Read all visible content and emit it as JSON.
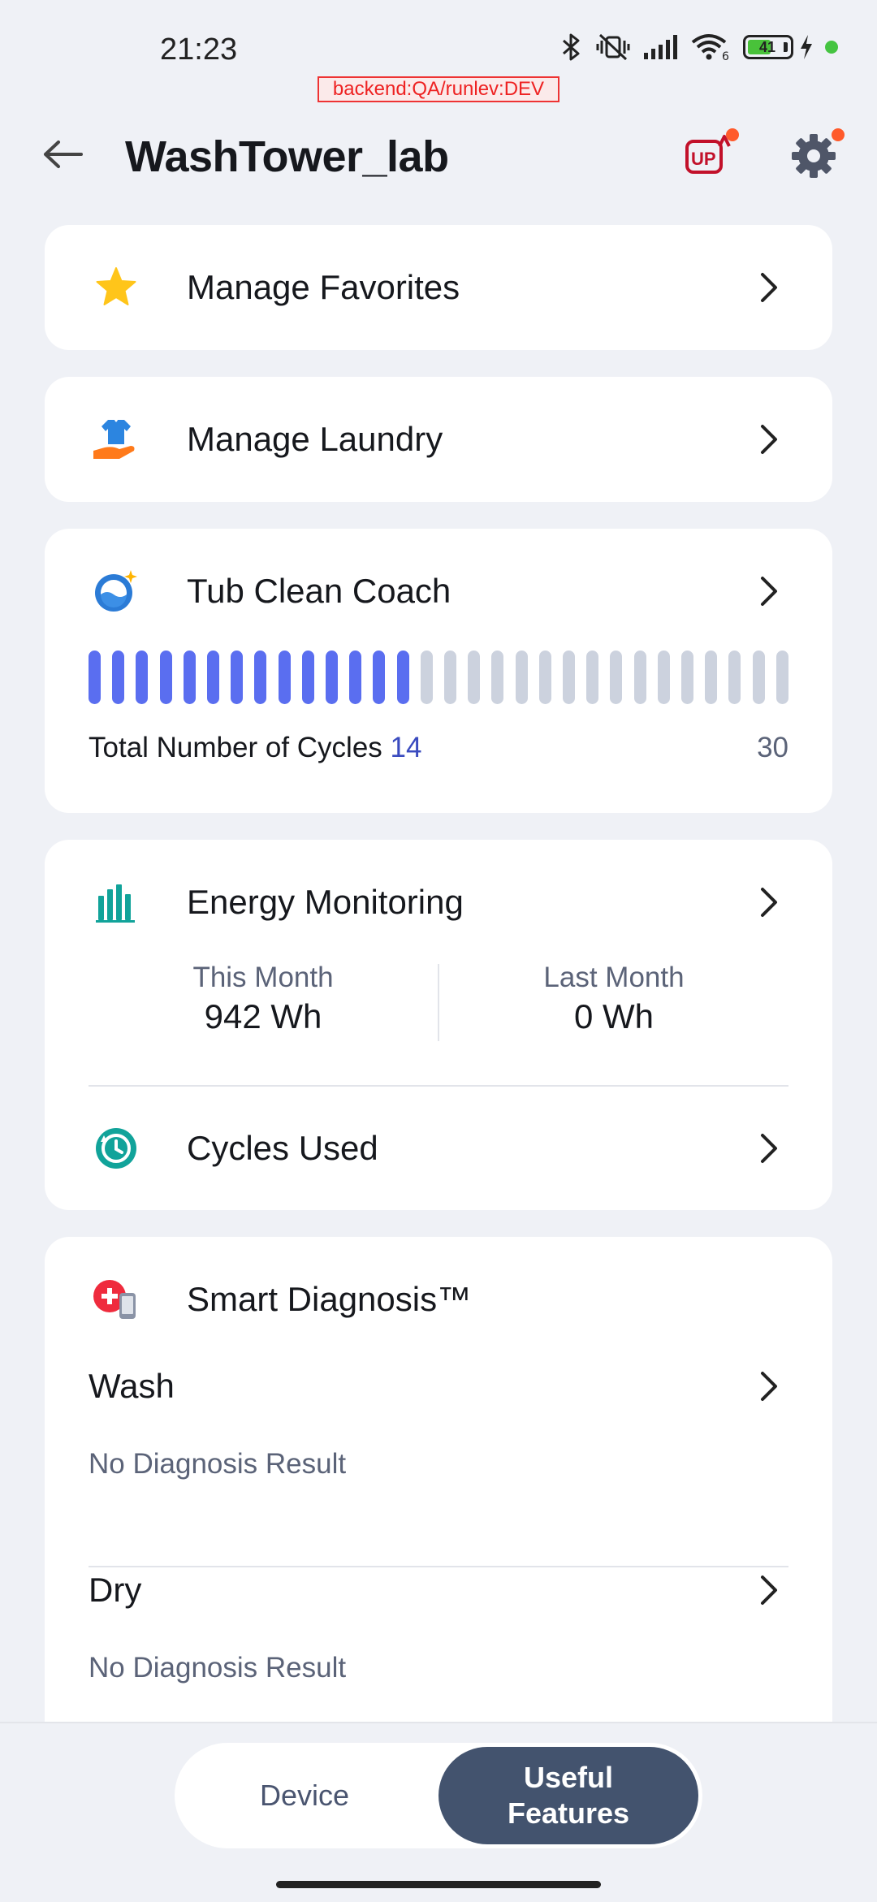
{
  "status_bar": {
    "time": "21:23",
    "battery": "41",
    "debug_banner": "backend:QA/runlev:DEV"
  },
  "header": {
    "title": "WashTower_lab"
  },
  "menu": {
    "favorites": "Manage Favorites",
    "laundry": "Manage Laundry"
  },
  "tub_clean": {
    "title": "Tub Clean Coach",
    "total_label": "Total Number of Cycles",
    "cycles": "14",
    "max": "30",
    "cycles_count": 14,
    "max_count": 30
  },
  "energy": {
    "title": "Energy Monitoring",
    "this_month_label": "This Month",
    "this_month_value": "942 Wh",
    "last_month_label": "Last Month",
    "last_month_value": "0 Wh",
    "cycles_used": "Cycles Used"
  },
  "diagnosis": {
    "title": "Smart Diagnosis™",
    "wash_label": "Wash",
    "wash_result": "No Diagnosis Result",
    "dry_label": "Dry",
    "dry_result": "No Diagnosis Result"
  },
  "tabs": {
    "device": "Device",
    "useful_line1": "Useful",
    "useful_line2": "Features"
  },
  "icons": {
    "back": "arrow-left-icon",
    "upgrade": "up-icon",
    "settings": "gear-icon",
    "favorites": "star-icon",
    "laundry": "shirt-hand-icon",
    "tub_clean": "tub-clean-icon",
    "energy": "bar-chart-icon",
    "cycles_used": "clock-history-icon",
    "diagnosis": "diagnosis-phone-icon"
  },
  "colors": {
    "progress_active": "#5a6ef0",
    "progress_inactive": "#ccd2de",
    "accent_value": "#3a4bbf",
    "tab_active_bg": "#43536e",
    "badge_red": "#ff5a2b"
  }
}
